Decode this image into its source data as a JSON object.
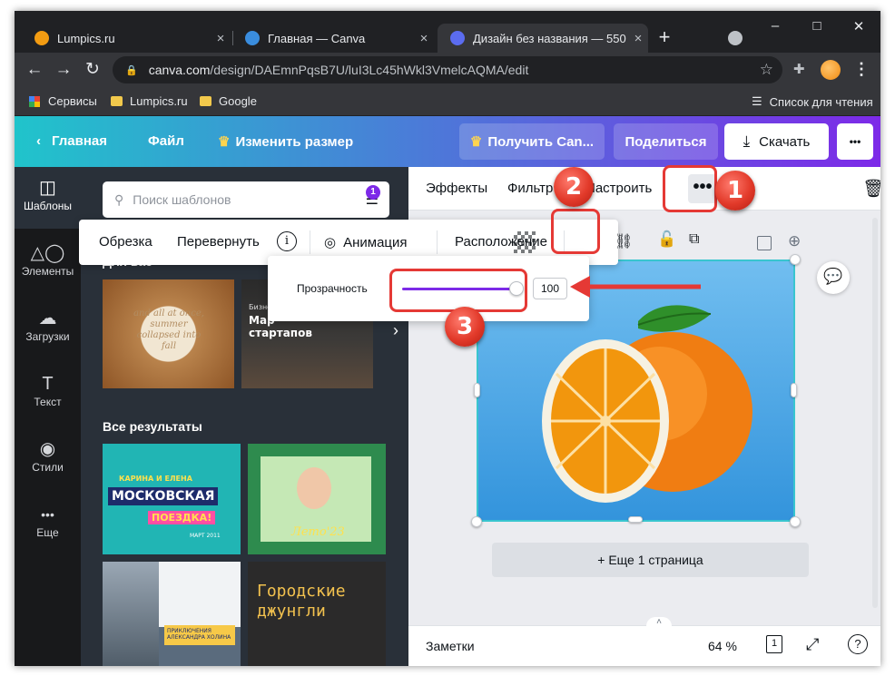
{
  "browser": {
    "tabs": [
      {
        "title": "Lumpics.ru",
        "close": "×"
      },
      {
        "title": "Главная — Canva",
        "close": "×"
      },
      {
        "title": "Дизайн без названия — 550 ×",
        "close": "×"
      }
    ],
    "new_tab": "+",
    "window_controls": {
      "minimize": "–",
      "maximize": "□",
      "close": "✕"
    },
    "nav": {
      "back": "←",
      "forward": "→",
      "reload": "↻"
    },
    "url": {
      "host": "canva.com",
      "path": "/design/DAEmnPqsB7U/luI3Lc45hWkl3VmelcAQMA/edit"
    },
    "bookmarks": [
      "Сервисы",
      "Lumpics.ru",
      "Google"
    ],
    "reading_list": "Список для чтения"
  },
  "canva": {
    "header": {
      "home": "Главная",
      "file": "Файл",
      "resize": "Изменить размер",
      "get_pro": "Получить Can...",
      "share": "Поделиться",
      "download": "Скачать",
      "more": "•••"
    },
    "rail": [
      {
        "label": "Шаблоны",
        "icon": "◫"
      },
      {
        "label": "Элементы",
        "icon": "△◯"
      },
      {
        "label": "Загрузки",
        "icon": "☁"
      },
      {
        "label": "Текст",
        "icon": "T"
      },
      {
        "label": "Стили",
        "icon": "◉"
      },
      {
        "label": "Еще",
        "icon": "•••"
      }
    ],
    "panel": {
      "search_placeholder": "Поиск шаблонов",
      "filter_badge": "1",
      "partial_heading": "Для вас",
      "all_results": "Все результаты",
      "thumb1_text": "and all at once, summer collapsed into fall",
      "thumb2_title": "Мар стартапов",
      "thumb2_pre": "Бизнес",
      "thumb3_top": "КАРИНА И ЕЛЕНА",
      "thumb3_main": "МОСКОВСКАЯ",
      "thumb3_sub": "ПОЕЗДКА!",
      "thumb3_date": "МАРТ 2011",
      "thumb4_text": "Лето'23",
      "thumb5_text": "ПРИКЛЮЧЕНИЯ АЛЕКСАНДРА ХОЛИНА",
      "thumb6_text": "Городские джунгли"
    },
    "context_toolbar": {
      "effects": "Эффекты",
      "filter": "Фильтр",
      "adjust": "Настроить",
      "more": "•••"
    },
    "float_toolbar": {
      "crop": "Обрезка",
      "flip": "Перевернуть",
      "info": "i",
      "animation": "Анимация",
      "position": "Расположение"
    },
    "transparency": {
      "label": "Прозрачность",
      "value": "100",
      "level": 1.0
    },
    "add_page": "+ Еще 1 страница",
    "footer": {
      "notes": "Заметки",
      "zoom": "64 %",
      "page_count": "1",
      "help": "?"
    }
  },
  "markers": [
    "1",
    "2",
    "3"
  ],
  "colors": {
    "accent": "#7d2ae8",
    "highlight": "#e53935",
    "selection": "#39c5cf"
  }
}
